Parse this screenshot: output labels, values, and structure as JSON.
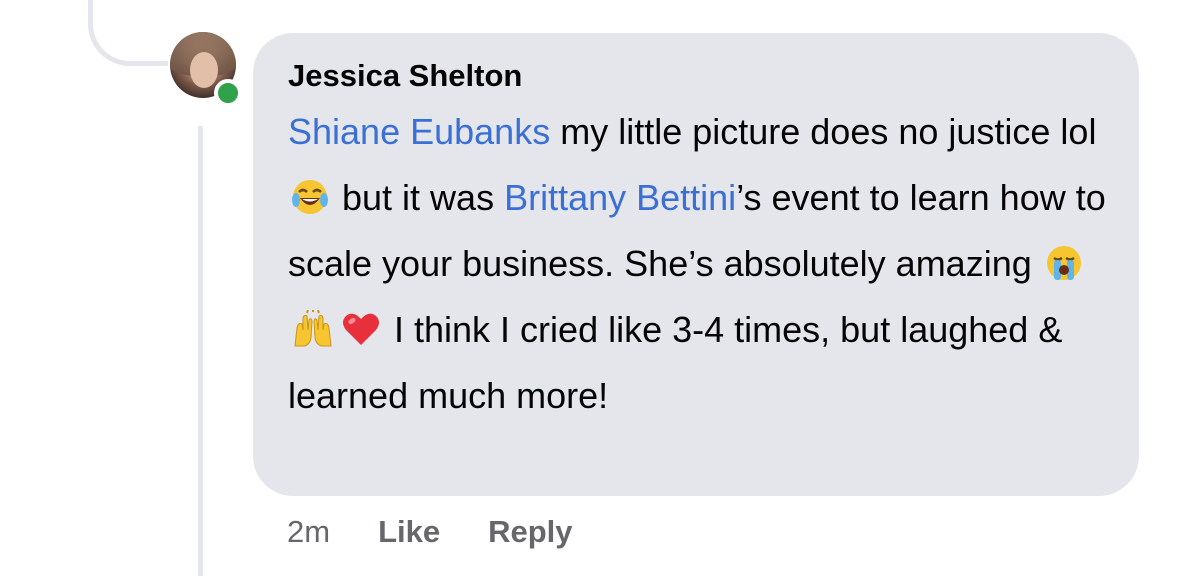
{
  "comment": {
    "author": "Jessica Shelton",
    "mention_1": "Shiane Eubanks",
    "text_1": " my little picture does no justice lol ",
    "text_2": " but it was ",
    "mention_2": "Brittany Bettini",
    "text_3": "’s event to learn how to scale your business. She’s absolutely amazing ",
    "text_4": " I think I cried like 3-4 times, but laughed & learned much more!",
    "emojis": [
      "face-with-tears-of-joy",
      "loudly-crying-face",
      "raising-hands",
      "red-heart"
    ]
  },
  "actions": {
    "time": "2m",
    "like": "Like",
    "reply": "Reply"
  },
  "colors": {
    "bubble": "#e4e6eb",
    "mention": "#3a6fd6",
    "online": "#31a24c",
    "meta": "#65676b"
  }
}
